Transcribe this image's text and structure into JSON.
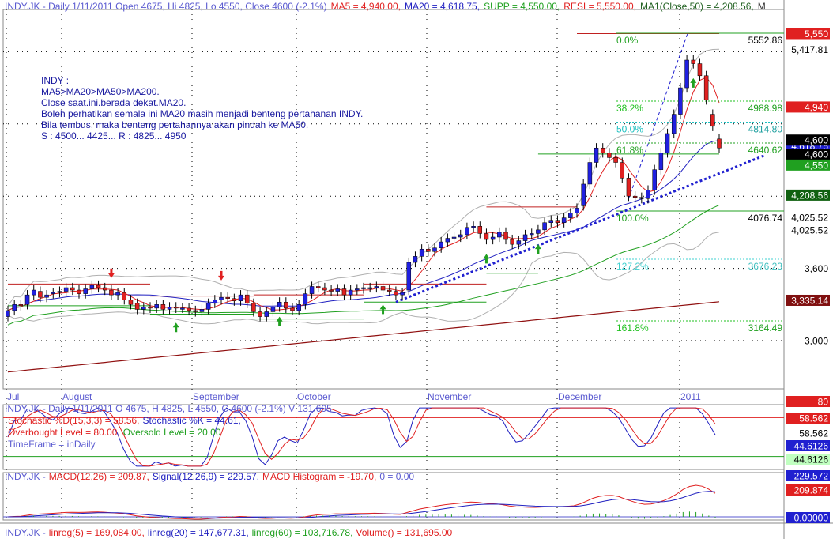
{
  "header": {
    "parts": [
      {
        "text": "INDY.JK - Daily 1/11/2011 Open 4675, Hi 4825, Lo 4550, Close 4600 (-2.1%)",
        "color": "#5a5ad0"
      },
      {
        "text": "MA5 = 4,940.00,",
        "color": "#e02020"
      },
      {
        "text": "MA20 = 4,618.75,",
        "color": "#2020c0"
      },
      {
        "text": "SUPP  = 4,550.00,",
        "color": "#20a020"
      },
      {
        "text": "RESI = 5,550.00,",
        "color": "#e02020"
      },
      {
        "text": "MA1(Close,50) = 4,208.56,",
        "color": "#206020"
      },
      {
        "text": "M",
        "color": "#333333"
      }
    ]
  },
  "annotation": {
    "lines": [
      "INDY :",
      "MA5>MA20>MA50>MA200.",
      "Close saat.ini.berada dekat.MA20.",
      "Boleh perhatikan semala ini MA20 masih menjadi benteng pertahanan INDY.",
      "Bila tembus, maka benteng pertahannya akan pindah ke MA50.",
      "S : 4500... 4425... R : 4825... 4950"
    ],
    "color": "#1a1aa0"
  },
  "price_axis_labels": [
    {
      "value": 5550,
      "text": "5,550",
      "bg": "#e02020",
      "fg": "#ffffff"
    },
    {
      "value": 5417.81,
      "text": "5,417.81",
      "bg": "#ffffff",
      "fg": "#000000"
    },
    {
      "value": 4940,
      "text": "4,940",
      "bg": "#e02020",
      "fg": "#ffffff"
    },
    {
      "value": 4618.75,
      "text": "4,618.75",
      "bg": "#2020d0",
      "fg": "#ffffff"
    },
    {
      "value": 4600,
      "text": "4,600",
      "bg": "#000000",
      "fg": "#ffffff",
      "offset": -10
    },
    {
      "value": 4600,
      "text": "4,600",
      "bg": "#000000",
      "fg": "#ffffff",
      "offset": 8
    },
    {
      "value": 4550,
      "text": "4,550",
      "bg": "#20a020",
      "fg": "#ffffff",
      "offset": 14
    },
    {
      "value": 4208.56,
      "text": "4,208.56",
      "bg": "#106010",
      "fg": "#ffffff"
    },
    {
      "value": 4025.52,
      "text": "4,025.52",
      "bg": "#ffffff",
      "fg": "#000000"
    },
    {
      "value": 4025.52,
      "text": "4,025.52",
      "bg": "#ffffff",
      "fg": "#000000",
      "offset": 16
    },
    {
      "value": 3600,
      "text": "3,600",
      "bg": "#ffffff",
      "fg": "#000000"
    },
    {
      "value": 3335.14,
      "text": "3,335.14",
      "bg": "#801010",
      "fg": "#ffffff"
    },
    {
      "value": 3000,
      "text": "3,000",
      "bg": "#ffffff",
      "fg": "#000000"
    }
  ],
  "fib_levels": [
    {
      "pct": "0.0%",
      "value": 5552.86,
      "value_text": "5552.86",
      "color": "#20a020",
      "label_color": "#20a020",
      "value_color": "#000000"
    },
    {
      "pct": "38.2%",
      "value": 4988.98,
      "value_text": "4988.98",
      "color": "#20c020",
      "label_color": "#20c020",
      "value_color": "#20a020"
    },
    {
      "pct": "50.0%",
      "value": 4814.8,
      "value_text": "4814.80",
      "color": "#20c0c0",
      "label_color": "#20c0c0",
      "value_color": "#20a0a0"
    },
    {
      "pct": "61.8%",
      "value": 4640.62,
      "value_text": "4640.62",
      "color": "#20a020",
      "label_color": "#20a020",
      "value_color": "#20a020"
    },
    {
      "pct": "100.0%",
      "value": 4076.74,
      "value_text": "4076.74",
      "color": "#20a020",
      "label_color": "#20a020",
      "value_color": "#000000"
    },
    {
      "pct": "127.2%",
      "value": 3676.23,
      "value_text": "3676.23",
      "color": "#40d0d0",
      "label_color": "#40d0d0",
      "value_color": "#40c0c0"
    },
    {
      "pct": "161.8%",
      "value": 3164.49,
      "value_text": "3164.49",
      "color": "#20c020",
      "label_color": "#20c020",
      "value_color": "#20a020"
    }
  ],
  "month_labels": [
    "Jul",
    "August",
    "September",
    "October",
    "November",
    "December",
    "2011"
  ],
  "stoch_panel": {
    "line1": [
      {
        "text": "INDY.JK - Daily 1/11/2011 O 4675, H 4825, L 4550, C 4600 (-2.1%) V 131,695",
        "color": "#5a5ad0"
      }
    ],
    "line2": [
      {
        "text": "Stochastic %D(15,3,3) = 58.56,",
        "color": "#e02020"
      },
      {
        "text": "Stochastic %K = 44.61,",
        "color": "#2020c0"
      }
    ],
    "line3": [
      {
        "text": "Overbought Level = 80.00,",
        "color": "#e02020"
      },
      {
        "text": "Oversold Level = 20.00",
        "color": "#20a020"
      }
    ],
    "line4": [
      {
        "text": "TimeFrame = inDaily",
        "color": "#5a5ad0"
      }
    ],
    "axis_labels": [
      {
        "text": "80",
        "bg": "#e02020",
        "fg": "#ffffff"
      },
      {
        "text": "58.562",
        "bg": "#e02020",
        "fg": "#ffffff"
      },
      {
        "text": "58.562",
        "bg": "#ffffff",
        "fg": "#000000"
      },
      {
        "text": "44.6126",
        "bg": "#2020d0",
        "fg": "#ffffff"
      },
      {
        "text": "44.6126",
        "bg": "#c0ffc0",
        "fg": "#000000"
      }
    ],
    "overbought": 80,
    "oversold": 20
  },
  "macd_panel": {
    "title_parts": [
      {
        "text": "INDY.JK -",
        "color": "#5a5ad0"
      },
      {
        "text": "MACD(12,26) = 209.87,",
        "color": "#e02020"
      },
      {
        "text": "Signal(12,26,9) = 229.57,",
        "color": "#2020c0"
      },
      {
        "text": "MACD Histogram = -19.70,",
        "color": "#e02020"
      },
      {
        "text": "0 = 0.00",
        "color": "#5a5ad0"
      }
    ],
    "axis_labels": [
      {
        "text": "229.572",
        "bg": "#2020d0",
        "fg": "#ffffff"
      },
      {
        "text": "209.874",
        "bg": "#e02020",
        "fg": "#ffffff"
      },
      {
        "text": "0.00000",
        "bg": "#2020d0",
        "fg": "#ffffff"
      }
    ]
  },
  "bottom_panel": {
    "parts": [
      {
        "text": "INDY.JK -",
        "color": "#5a5ad0"
      },
      {
        "text": "linreg(5) = 169,084.00,",
        "color": "#e02020"
      },
      {
        "text": "linreg(20) = 147,677.31,",
        "color": "#2020c0"
      },
      {
        "text": "linreg(60) = 103,716.78,",
        "color": "#20a020"
      },
      {
        "text": "Volume() = 131,695.00",
        "color": "#e02020"
      }
    ]
  },
  "colors": {
    "up_candle": "#2020e0",
    "down_candle": "#e02020",
    "ma5": "#e02020",
    "ma20": "#2020c0",
    "ma50": "#20a020",
    "ma200": "#901010",
    "bollinger": "#b0b0b0",
    "trendline": "#2020d0",
    "grid": "#000000"
  },
  "chart_data": {
    "type": "candlestick",
    "title": "INDY.JK - Daily 1/11/2011",
    "ylim": [
      2600,
      5750
    ],
    "ohlc_last": {
      "open": 4675,
      "high": 4825,
      "low": 4550,
      "close": 4600
    },
    "closes": [
      3250,
      3300,
      3290,
      3380,
      3420,
      3360,
      3380,
      3400,
      3410,
      3440,
      3420,
      3390,
      3430,
      3460,
      3440,
      3420,
      3380,
      3400,
      3340,
      3300,
      3260,
      3280,
      3270,
      3300,
      3260,
      3280,
      3270,
      3270,
      3250,
      3240,
      3260,
      3310,
      3340,
      3360,
      3350,
      3330,
      3380,
      3310,
      3240,
      3200,
      3240,
      3280,
      3320,
      3270,
      3250,
      3300,
      3390,
      3450,
      3440,
      3420,
      3410,
      3430,
      3380,
      3420,
      3430,
      3440,
      3440,
      3450,
      3420,
      3410,
      3380,
      3400,
      3650,
      3700,
      3760,
      3740,
      3770,
      3820,
      3850,
      3860,
      3880,
      3940,
      3950,
      3890,
      3840,
      3860,
      3900,
      3840,
      3800,
      3830,
      3880,
      3890,
      3920,
      3980,
      4000,
      3980,
      4020,
      4060,
      4100,
      4300,
      4480,
      4600,
      4560,
      4520,
      4480,
      4350,
      4200,
      4190,
      4180,
      4250,
      4420,
      4560,
      4720,
      4880,
      5100,
      5330,
      5300,
      5200,
      5000,
      4780,
      4600
    ],
    "opens": [
      3200,
      3250,
      3300,
      3300,
      3380,
      3410,
      3360,
      3390,
      3400,
      3410,
      3440,
      3420,
      3390,
      3430,
      3460,
      3440,
      3420,
      3380,
      3400,
      3340,
      3310,
      3260,
      3280,
      3270,
      3300,
      3260,
      3280,
      3270,
      3270,
      3250,
      3240,
      3260,
      3310,
      3340,
      3360,
      3350,
      3330,
      3380,
      3310,
      3240,
      3200,
      3240,
      3280,
      3320,
      3270,
      3250,
      3300,
      3390,
      3450,
      3440,
      3420,
      3410,
      3430,
      3380,
      3420,
      3430,
      3440,
      3440,
      3450,
      3420,
      3410,
      3380,
      3420,
      3650,
      3700,
      3760,
      3740,
      3770,
      3820,
      3850,
      3860,
      3880,
      3940,
      3950,
      3890,
      3840,
      3860,
      3900,
      3840,
      3800,
      3830,
      3880,
      3890,
      3920,
      3980,
      4000,
      3980,
      4020,
      4060,
      4120,
      4300,
      4480,
      4600,
      4560,
      4520,
      4480,
      4350,
      4200,
      4190,
      4180,
      4250,
      4420,
      4560,
      4720,
      4880,
      5100,
      5330,
      5300,
      5200,
      4880,
      4675
    ],
    "series": [
      {
        "name": "MA5",
        "value_last": 4940
      },
      {
        "name": "MA20",
        "value_last": 4618.75
      },
      {
        "name": "MA1(Close,50)",
        "value_last": 4208.56
      }
    ],
    "supp": 4550,
    "resi": 5550,
    "stochastic": {
      "d_last": 58.56,
      "k_last": 44.61
    },
    "macd": {
      "macd_last": 209.87,
      "signal_last": 229.57,
      "hist_last": -19.7
    }
  }
}
